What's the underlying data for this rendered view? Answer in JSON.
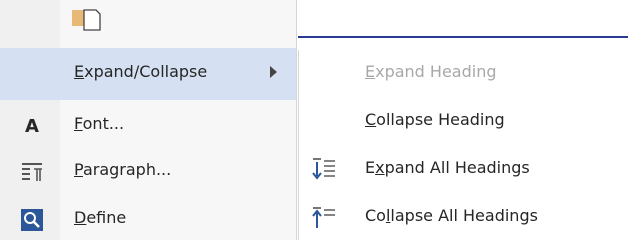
{
  "left_menu": {
    "items": [
      {
        "pre": "",
        "ul": "E",
        "post": "xpand/Collapse"
      },
      {
        "pre": "",
        "ul": "F",
        "post": "ont..."
      },
      {
        "pre": "",
        "ul": "P",
        "post": "aragraph..."
      },
      {
        "pre": "",
        "ul": "D",
        "post": "efine"
      }
    ],
    "font_icon_glyph": "A"
  },
  "submenu": {
    "items": [
      {
        "pre": "",
        "ul": "E",
        "post": "xpand Heading",
        "state": "disabled"
      },
      {
        "pre": "",
        "ul": "C",
        "post": "ollapse Heading",
        "state": "enabled"
      },
      {
        "pre": "E",
        "ul": "x",
        "post": "pand All Headings",
        "state": "enabled"
      },
      {
        "pre": "Co",
        "ul": "l",
        "post": "lapse All Headings",
        "state": "enabled"
      }
    ]
  },
  "colors": {
    "highlight": "#d5e1f2",
    "accent_blue": "#2b579a",
    "doc_line": "#2b3a93",
    "disabled_text": "#a8a8a8"
  }
}
